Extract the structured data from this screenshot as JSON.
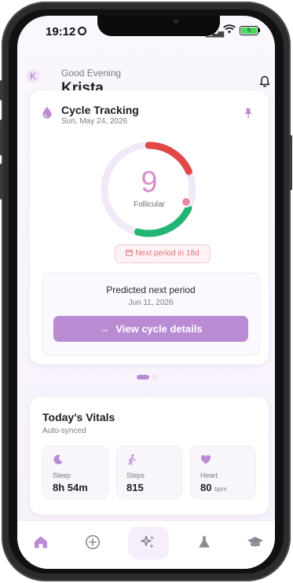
{
  "status_bar": {
    "time": "19:12"
  },
  "header": {
    "avatar_letter": "K",
    "greeting": "Good Evening",
    "user_name": "Krista",
    "bell_icon": "bell-icon"
  },
  "cycle_card": {
    "title": "Cycle Tracking",
    "date": "Sun, May 24, 2026",
    "cycle_day": "9",
    "phase": "Follicular",
    "next_period_badge": "Next period in 18d",
    "predicted_title": "Predicted next period",
    "predicted_date": "Jun 11, 2026",
    "view_button": "View cycle details",
    "colors": {
      "menstrual": "#e04848",
      "follicular_marker": "#e58aa8",
      "fertile": "#22b573",
      "track": "#f1e8f8",
      "accent": "#b98bd3"
    }
  },
  "carousel": {
    "page_count": 2,
    "active_index": 0
  },
  "vitals_card": {
    "title": "Today's Vitals",
    "subtitle": "Auto-synced",
    "tiles": [
      {
        "icon": "moon-icon",
        "label": "Sleep",
        "value": "8h 54m",
        "unit": ""
      },
      {
        "icon": "walking-icon",
        "label": "Steps",
        "value": "815",
        "unit": ""
      },
      {
        "icon": "heart-icon",
        "label": "Heart",
        "value": "80",
        "unit": "bpm"
      }
    ]
  },
  "tab_bar": {
    "tabs": [
      {
        "icon": "home-icon",
        "active": true
      },
      {
        "icon": "add-circle-icon",
        "active": false
      },
      {
        "icon": "sparkles-icon",
        "active": false
      },
      {
        "icon": "flask-icon",
        "active": false
      },
      {
        "icon": "graduation-cap-icon",
        "active": false
      }
    ]
  }
}
